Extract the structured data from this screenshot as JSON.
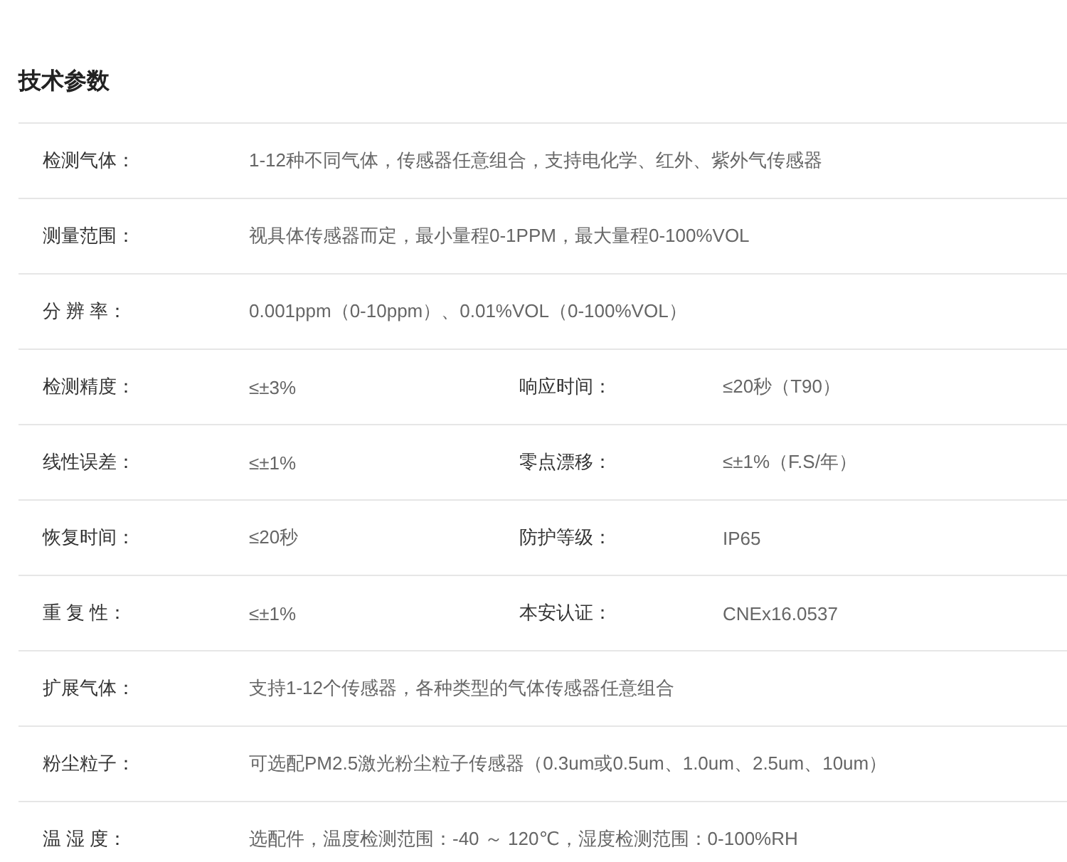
{
  "title": "技术参数",
  "rows": [
    {
      "pairs": [
        {
          "label": "检测气体：",
          "value": "1-12种不同气体，传感器任意组合，支持电化学、红外、紫外气传感器"
        }
      ]
    },
    {
      "pairs": [
        {
          "label": "测量范围：",
          "value": "视具体传感器而定，最小量程0-1PPM，最大量程0-100%VOL"
        }
      ]
    },
    {
      "pairs": [
        {
          "label": "分 辨 率：",
          "value": "0.001ppm（0-10ppm）、0.01%VOL（0-100%VOL）"
        }
      ]
    },
    {
      "pairs": [
        {
          "label": "检测精度：",
          "value": "≤±3%"
        },
        {
          "label": "响应时间：",
          "value": "≤20秒（T90）"
        }
      ]
    },
    {
      "pairs": [
        {
          "label": "线性误差：",
          "value": "≤±1%"
        },
        {
          "label": "零点漂移：",
          "value": "≤±1%（F.S/年）"
        }
      ]
    },
    {
      "pairs": [
        {
          "label": "恢复时间：",
          "value": "≤20秒"
        },
        {
          "label": "防护等级：",
          "value": "IP65"
        }
      ]
    },
    {
      "pairs": [
        {
          "label": "重 复 性：",
          "value": "≤±1%"
        },
        {
          "label": "本安认证：",
          "value": "CNEx16.0537"
        }
      ]
    },
    {
      "pairs": [
        {
          "label": "扩展气体：",
          "value": "支持1-12个传感器，各种类型的气体传感器任意组合"
        }
      ]
    },
    {
      "pairs": [
        {
          "label": "粉尘粒子：",
          "value": "可选配PM2.5激光粉尘粒子传感器（0.3um或0.5um、1.0um、2.5um、10um）"
        }
      ]
    },
    {
      "pairs": [
        {
          "label": "温 湿 度：",
          "value": "选配件，温度检测范围：-40 ～ 120℃，湿度检测范围：0-100%RH"
        }
      ]
    }
  ]
}
